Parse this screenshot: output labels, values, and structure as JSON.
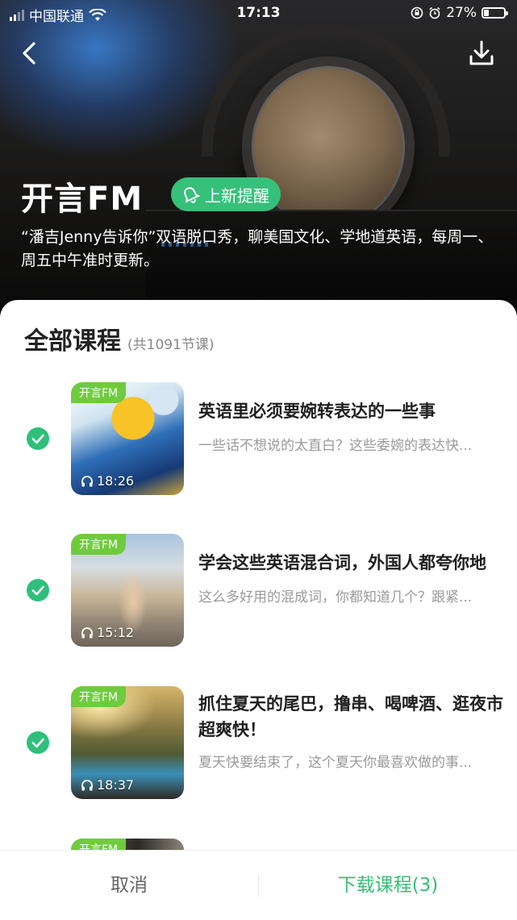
{
  "status_bar": {
    "carrier": "中国联通",
    "time": "17:13",
    "battery": "27%",
    "battery_level": 0.27
  },
  "header": {
    "title": "开言FM",
    "remind_label": "上新提醒",
    "description": "“潘吉Jenny告诉你”双语脱口秀，聊美国文化、学地道英语，每周一、周五中午准时更新。"
  },
  "section": {
    "title": "全部课程",
    "count": "(共1091节课)"
  },
  "courses": [
    {
      "tag": "开言FM",
      "duration": "18:26",
      "title": "英语里必须要婉转表达的一些事",
      "subtitle": "一些话不想说的太直白？这些委婉的表达快...",
      "checked": true
    },
    {
      "tag": "开言FM",
      "duration": "15:12",
      "title": "学会这些英语混合词，外国人都夸你地",
      "subtitle": "这么多好用的混成词，你都知道几个？跟紧...",
      "checked": true
    },
    {
      "tag": "开言FM",
      "duration": "18:37",
      "title": "抓住夏天的尾巴，撸串、喝啤酒、逛夜市超爽快！",
      "subtitle": "夏天快要结束了，这个夏天你最喜欢做的事...",
      "checked": true
    },
    {
      "tag": "开言FM"
    }
  ],
  "bottom_bar": {
    "cancel_label": "取消",
    "download_label": "下载课程(3)"
  },
  "colors": {
    "accent": "#37c07a",
    "tag_green": "#6fcb3e",
    "check_green": "#2fbf7b"
  }
}
